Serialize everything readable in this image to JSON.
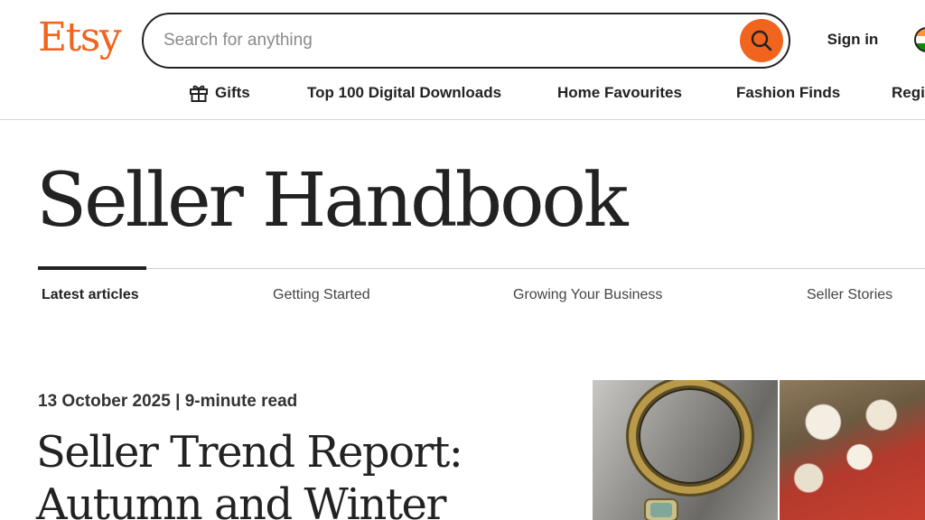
{
  "header": {
    "logo_text": "Etsy",
    "search": {
      "placeholder": "Search for anything",
      "value": ""
    },
    "sign_in_label": "Sign in",
    "locale": "flag-icon"
  },
  "subnav": {
    "items": [
      {
        "label": "Gifts",
        "icon": "gift-icon"
      },
      {
        "label": "Top 100 Digital Downloads"
      },
      {
        "label": "Home Favourites"
      },
      {
        "label": "Fashion Finds"
      },
      {
        "label": "Regi"
      }
    ]
  },
  "page": {
    "title": "Seller Handbook",
    "tabs": [
      {
        "label": "Latest articles",
        "active": true
      },
      {
        "label": "Getting Started",
        "active": false
      },
      {
        "label": "Growing Your Business",
        "active": false
      },
      {
        "label": "Seller Stories",
        "active": false
      }
    ]
  },
  "featured": {
    "date": "13 October 2025",
    "separator": "|",
    "read_time": "9-minute read",
    "title": "Seller Trend Report: Autumn and Winter"
  },
  "colors": {
    "brand": "#f1641e",
    "text": "#222222",
    "divider": "#d6d6d6"
  }
}
